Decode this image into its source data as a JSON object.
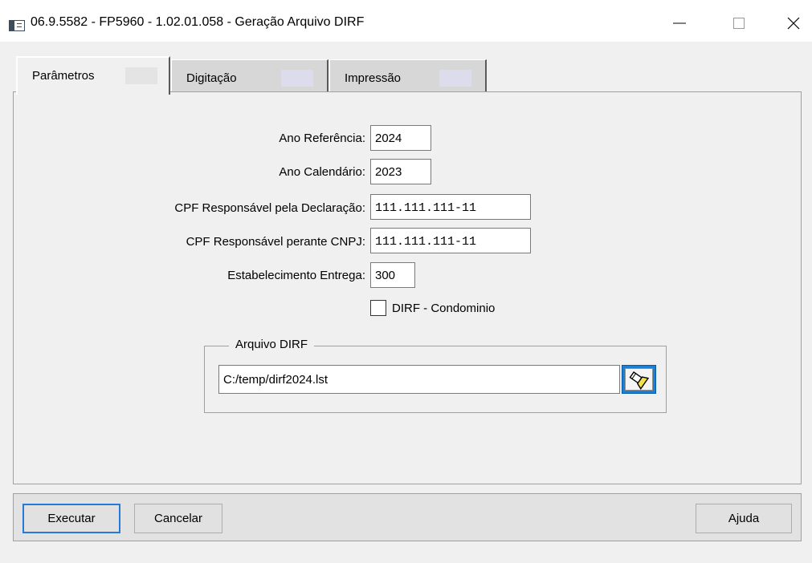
{
  "window": {
    "title": "06.9.5582 - FP5960 - 1.02.01.058 - Geração Arquivo DIRF",
    "icons": [
      "app-icon",
      "minimize-icon",
      "maximize-icon",
      "close-icon"
    ]
  },
  "tabs": [
    {
      "label": "Parâmetros",
      "active": true
    },
    {
      "label": "Digitação",
      "active": false
    },
    {
      "label": "Impressão",
      "active": false
    }
  ],
  "form": {
    "ano_referencia": {
      "label": "Ano Referência:",
      "value": "2024"
    },
    "ano_calendario": {
      "label": "Ano Calendário:",
      "value": "2023"
    },
    "cpf_declaracao": {
      "label": "CPF Responsável pela Declaração:",
      "value": "111.111.111-11"
    },
    "cpf_cnpj": {
      "label": "CPF Responsável perante CNPJ:",
      "value": "111.111.111-11"
    },
    "estabelecimento": {
      "label": "Estabelecimento Entrega:",
      "value": "300"
    },
    "dirf_condominio": {
      "label": "DIRF - Condominio",
      "checked": false
    }
  },
  "arquivo": {
    "group_title": "Arquivo DIRF",
    "path": "C:/temp/dirf2024.lst",
    "browse_icon": "flashlight-search-icon"
  },
  "buttons": {
    "executar": "Executar",
    "cancelar": "Cancelar",
    "ajuda": "Ajuda"
  },
  "colors": {
    "accent": "#2679d4",
    "background": "#f0f0f0"
  }
}
